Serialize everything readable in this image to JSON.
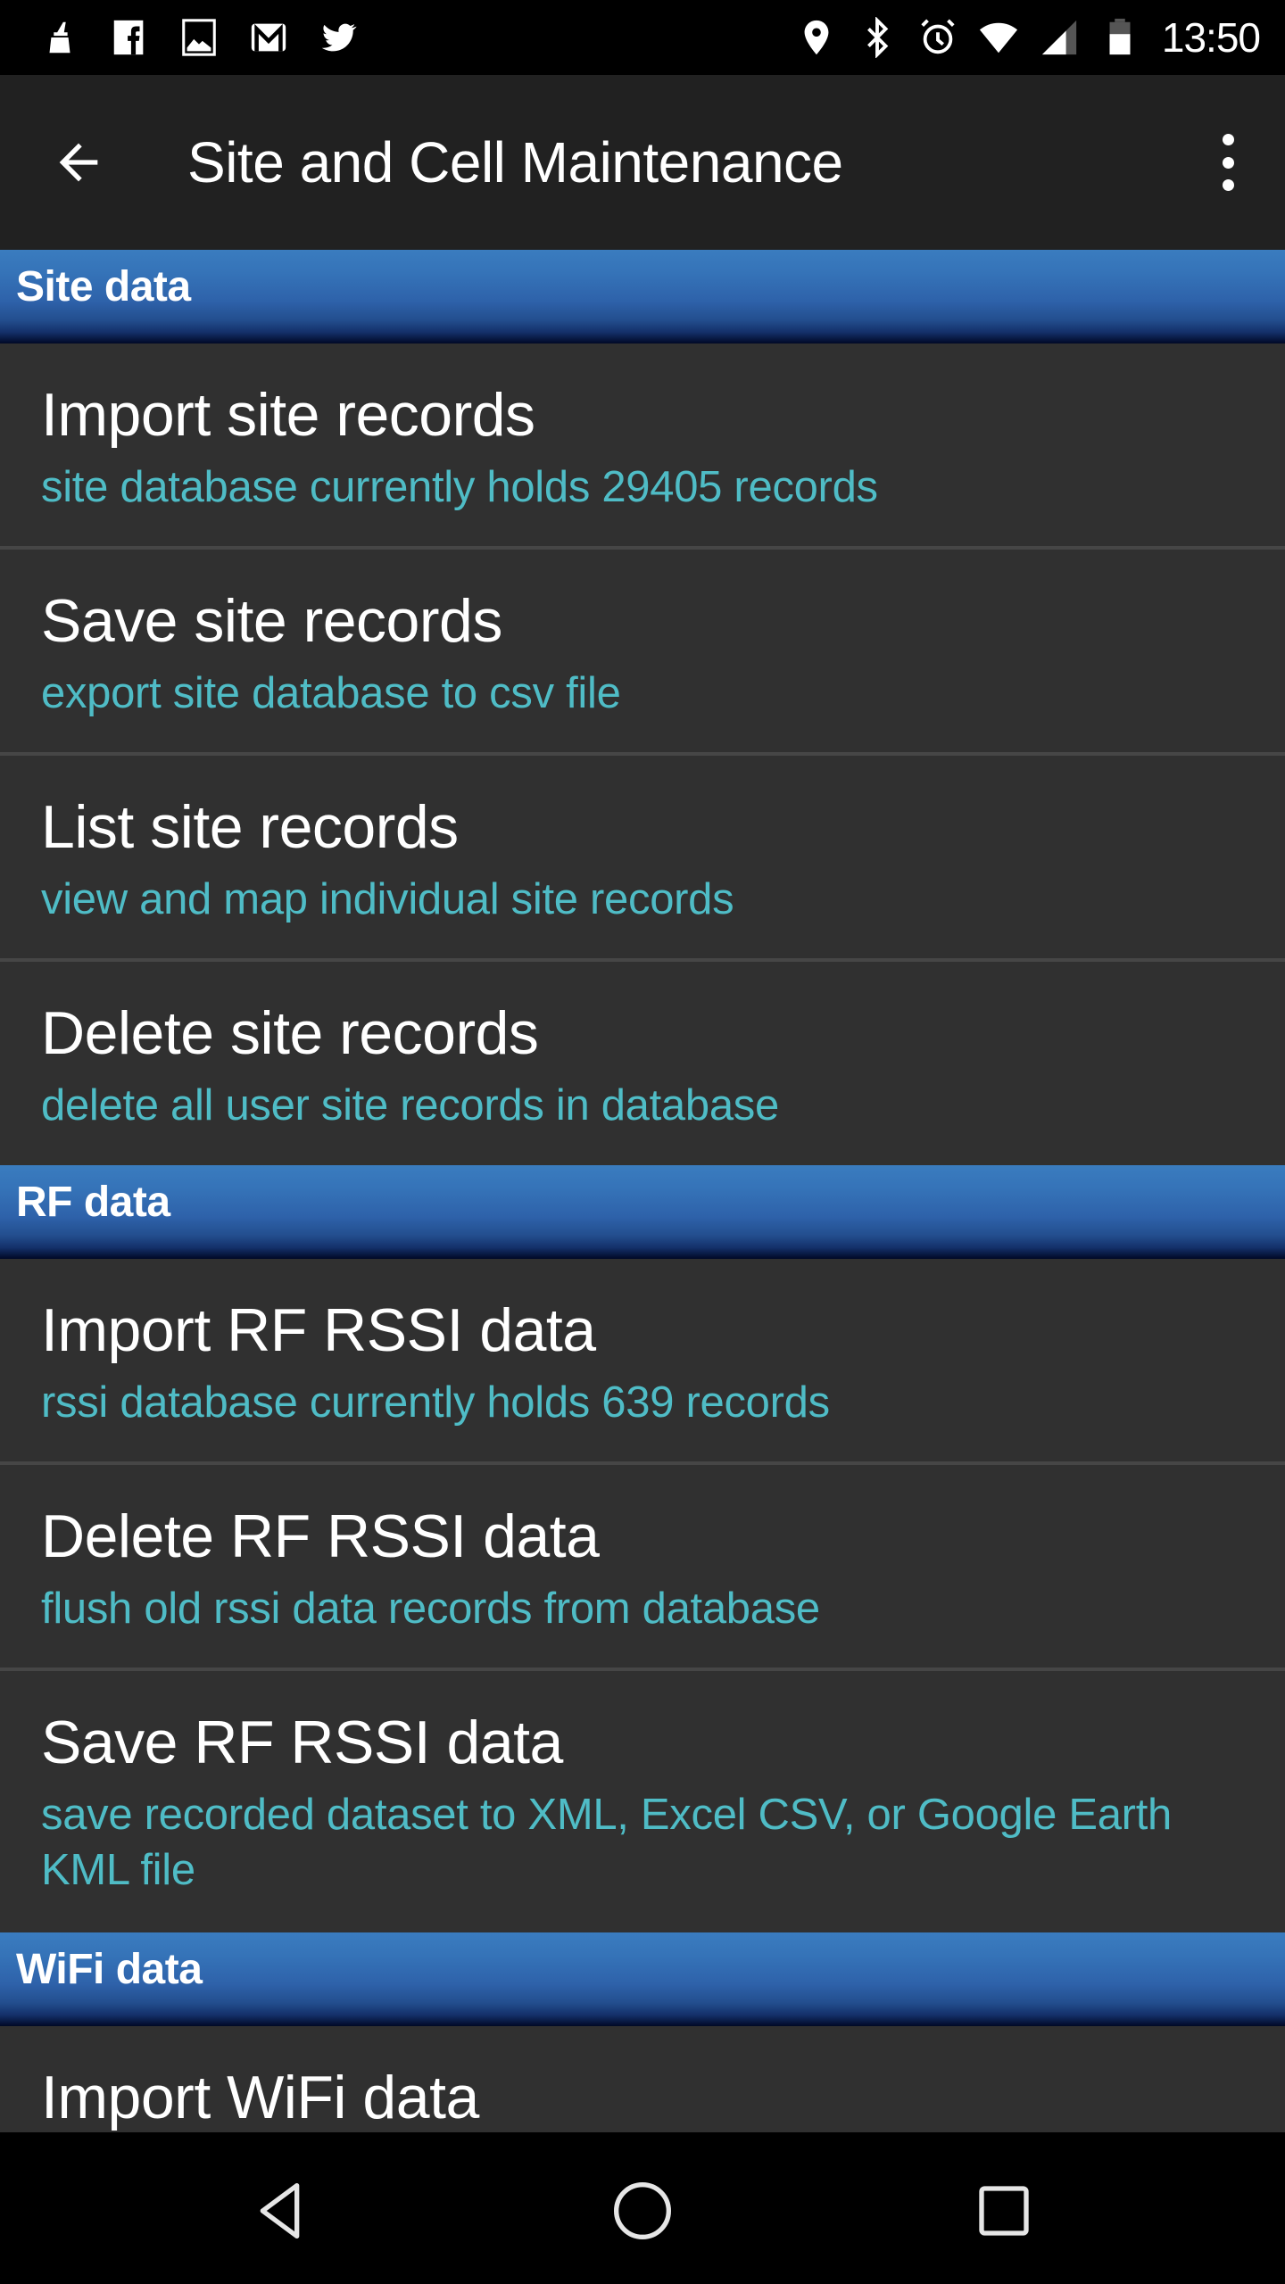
{
  "status_bar": {
    "notification_icons": [
      "cleaner-broom-icon",
      "facebook-icon",
      "gallery-image-icon",
      "gmail-icon",
      "twitter-icon"
    ],
    "system_icons": [
      "location-pin-icon",
      "bluetooth-icon",
      "alarm-clock-icon",
      "wifi-icon",
      "cell-signal-icon",
      "battery-icon"
    ],
    "time": "13:50"
  },
  "app_bar": {
    "back_icon": "arrow-back-icon",
    "title": "Site and Cell Maintenance",
    "overflow_icon": "more-vert-icon"
  },
  "sections": [
    {
      "title": "Site data",
      "items": [
        {
          "title": "Import site records",
          "subtitle": "site database currently holds  29405  records"
        },
        {
          "title": "Save site records",
          "subtitle": "export site database to csv file"
        },
        {
          "title": "List site records",
          "subtitle": "view and map individual site records"
        },
        {
          "title": "Delete site records",
          "subtitle": "delete all user site records in database"
        }
      ]
    },
    {
      "title": "RF data",
      "items": [
        {
          "title": "Import RF RSSI data",
          "subtitle": "rssi database currently holds  639  records"
        },
        {
          "title": "Delete RF RSSI data",
          "subtitle": "flush old rssi data records from database"
        },
        {
          "title": "Save RF RSSI data",
          "subtitle": "save recorded dataset to XML, Excel CSV, or Google Earth KML file"
        }
      ]
    },
    {
      "title": "WiFi data",
      "items": [
        {
          "title": "Import WiFi data",
          "subtitle": ""
        }
      ]
    }
  ],
  "counts": {
    "site_records": 29405,
    "rssi_records": 639
  },
  "nav_bar": {
    "buttons": [
      "nav-back-icon",
      "nav-home-icon",
      "nav-recents-icon"
    ]
  },
  "colors": {
    "background": "#303030",
    "app_bar": "#212121",
    "subtitle_accent": "#4fbcc6",
    "section_header_top": "#3a7cbf",
    "section_header_bottom": "#000826",
    "divider": "#464646"
  }
}
